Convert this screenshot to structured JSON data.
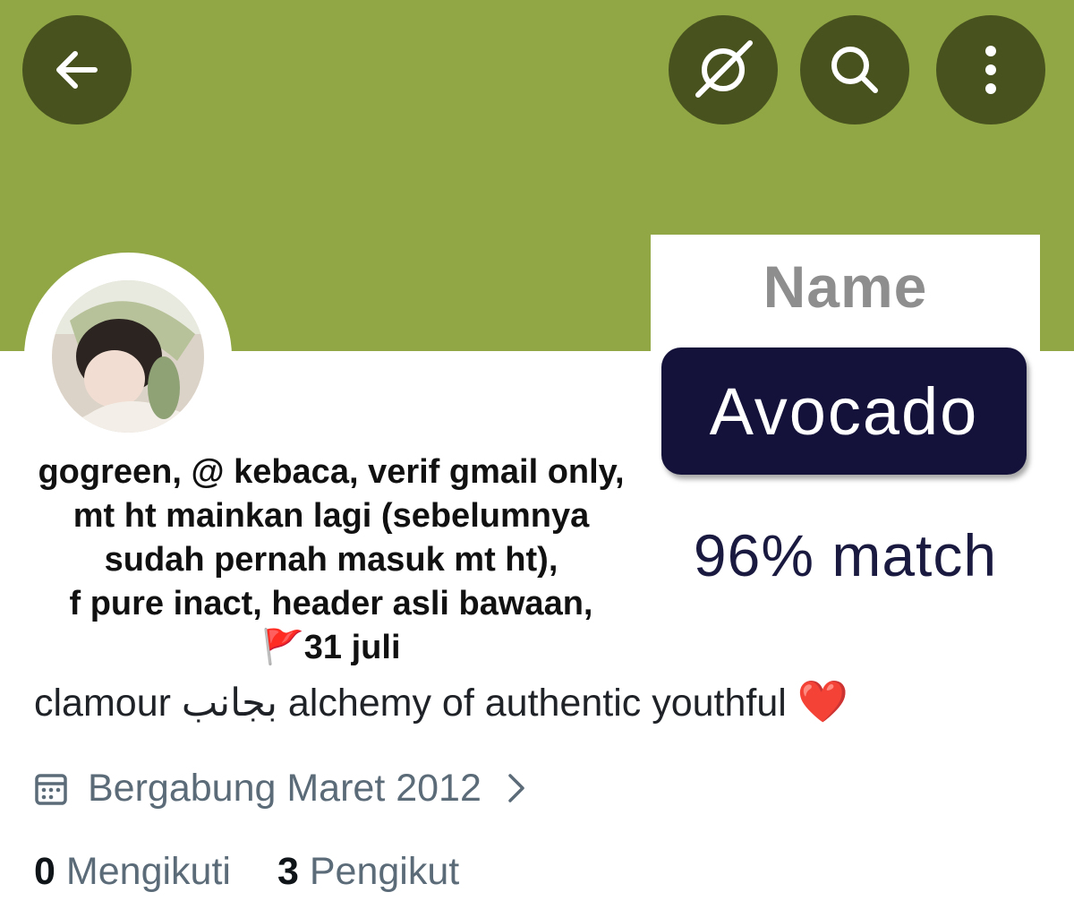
{
  "colors": {
    "banner": "#91a745",
    "icon_button_bg": "#47521f",
    "badge_bg": "#14123a",
    "muted_text": "#5b6b78"
  },
  "toolbar": {
    "back_icon": "arrow-left-icon",
    "grok_icon": "grok-icon",
    "search_icon": "search-icon",
    "more_icon": "more-vertical-icon"
  },
  "overlay": {
    "name_label": "Name",
    "result": "Avocado",
    "match": "96% match"
  },
  "caption": {
    "line1": "gogreen, @ kebaca, verif gmail only,",
    "line2": "mt ht mainkan lagi (sebelumnya",
    "line3": "sudah pernah masuk mt ht),",
    "line4": "f pure inact, header asli bawaan,",
    "line5_icon": "🚩",
    "line5_text": "31 juli"
  },
  "profile": {
    "bio": "clamour بجانب alchemy of authentic youthful",
    "bio_emoji": "❤️",
    "joined": "Bergabung Maret 2012",
    "following_count": "0",
    "following_label": "Mengikuti",
    "followers_count": "3",
    "followers_label": "Pengikut"
  }
}
